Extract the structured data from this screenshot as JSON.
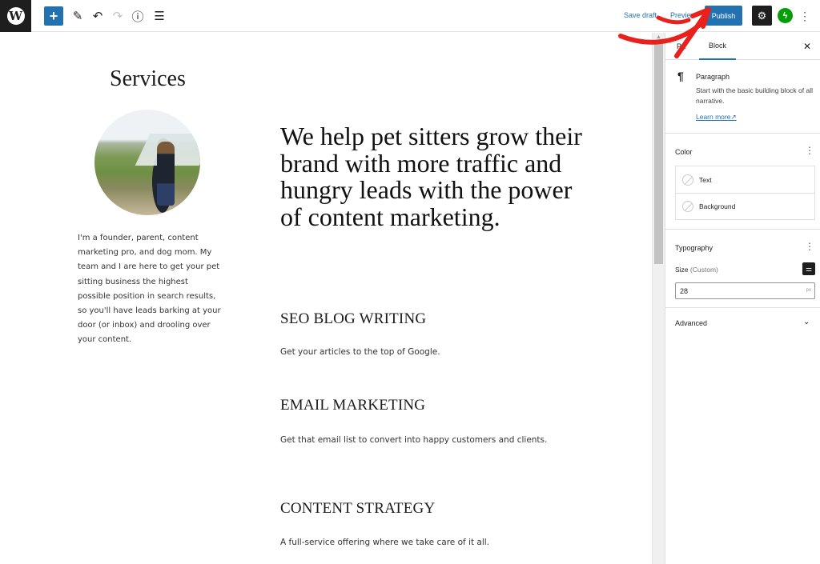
{
  "toolbar": {
    "logo_glyph": "W",
    "add_glyph": "+",
    "edit_glyph": "✎",
    "undo_glyph": "↶",
    "redo_glyph": "↷",
    "info_glyph": "ⓘ",
    "list_glyph": "☰",
    "save_draft": "Save draft",
    "preview": "Preview",
    "publish": "Publish",
    "settings_glyph": "⚙",
    "jetpack_glyph": "ϟ",
    "more_glyph": "⋮",
    "accent_color": "#2271b1"
  },
  "content": {
    "page_title": "Services",
    "bio": "I'm a founder, parent, content marketing pro, and dog mom. My team and I are here to get your pet sitting business the highest possible position in search results, so you'll have leads barking at your door (or inbox) and drooling over your content.",
    "hero": "We help pet sitters grow their brand with more traffic and hungry leads with the power of content marketing.",
    "services": [
      {
        "title": "SEO BLOG WRITING",
        "description": "Get your articles to the top of Google."
      },
      {
        "title": "EMAIL MARKETING",
        "description": "Get that email list to convert into happy customers and clients."
      },
      {
        "title": "CONTENT STRATEGY",
        "description": "A full-service offering where we take care of it all."
      }
    ]
  },
  "sidebar": {
    "tabs": {
      "post": "Pa",
      "block": "Block",
      "close_glyph": "✕"
    },
    "block": {
      "icon_glyph": "¶",
      "name": "Paragraph",
      "description": "Start with the basic building block of all narrative.",
      "learn_more": "Learn more↗"
    },
    "color": {
      "title": "Color",
      "more_glyph": "⋮",
      "items": [
        "Text",
        "Background"
      ]
    },
    "typography": {
      "title": "Typography",
      "more_glyph": "⋮",
      "size_label": "Size",
      "size_mode": "(Custom)",
      "size_toggle_glyph": "⚌",
      "size_value": "28",
      "size_unit": "px"
    },
    "advanced": {
      "title": "Advanced",
      "chevron_glyph": "⌄"
    }
  },
  "scrollbar": {
    "up_glyph": "▲"
  },
  "annotation": {
    "arrow_color": "#e8211c"
  }
}
